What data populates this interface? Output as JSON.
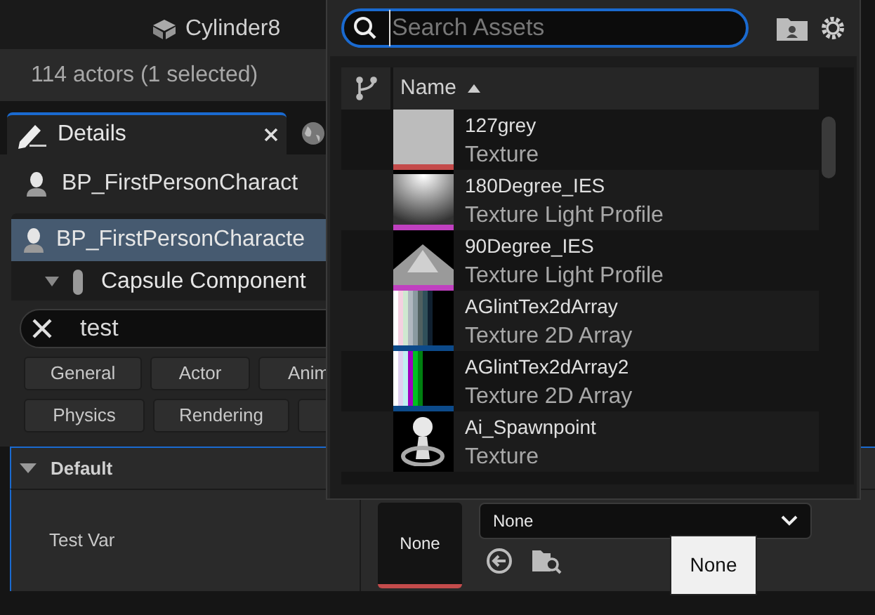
{
  "outliner": {
    "rows": [
      {
        "label": "Cylinder8"
      }
    ]
  },
  "status_bar": "114 actors (1 selected)",
  "details_tab": {
    "label": "Details",
    "selected": true
  },
  "actor": {
    "name": "BP_FirstPersonCharact"
  },
  "components": [
    {
      "label": "BP_FirstPersonCharacte",
      "selected": true,
      "kind": "actor"
    },
    {
      "label": "Capsule Component",
      "selected": false,
      "kind": "capsule"
    }
  ],
  "search": {
    "value": "test"
  },
  "filters": [
    [
      "General",
      "Actor",
      "Anim"
    ],
    [
      "Physics",
      "Rendering"
    ]
  ],
  "section": {
    "title": "Default",
    "expanded": true
  },
  "property": {
    "label": "Test Var",
    "thumbnail": "None",
    "value": "None",
    "tooltip": "None"
  },
  "picker": {
    "search": {
      "placeholder": "Search Assets"
    },
    "columns": [
      {
        "label": "Name",
        "sorted_ascending": true
      }
    ],
    "assets": [
      {
        "name": "127grey",
        "type": "Texture",
        "color": "#c44b4b"
      },
      {
        "name": "180Degree_IES",
        "type": "Texture Light Profile",
        "color": "#c040c0"
      },
      {
        "name": "90Degree_IES",
        "type": "Texture Light Profile",
        "color": "#c040c0"
      },
      {
        "name": "AGlintTex2dArray",
        "type": "Texture 2D Array",
        "color": "#0c4a8a"
      },
      {
        "name": "AGlintTex2dArray2",
        "type": "Texture 2D Array",
        "color": "#0c4a8a"
      },
      {
        "name": "Ai_Spawnpoint",
        "type": "Texture",
        "color": "#000000"
      }
    ]
  }
}
